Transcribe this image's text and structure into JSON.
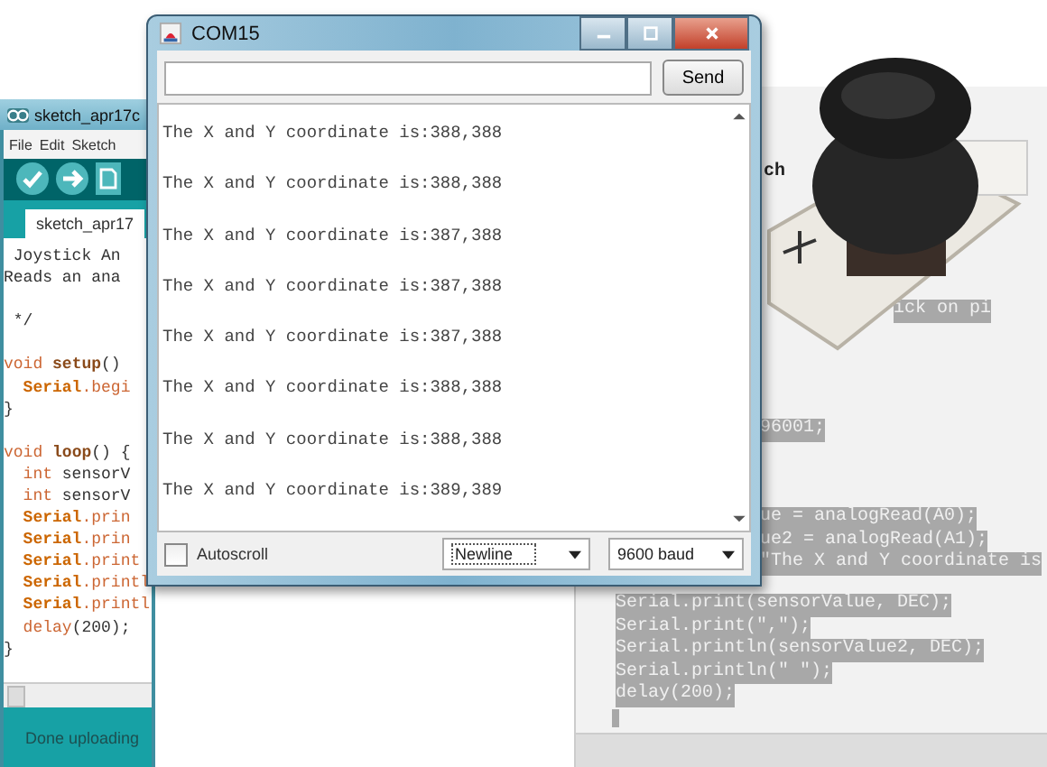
{
  "background_editor": {
    "fragments": [
      [
        "ch"
      ],
      [
        "ick on pi"
      ],
      [
        "96001;"
      ],
      [
        "ue = analogRead(A0);",
        "ue2 = analogRead(A1);",
        "\"The X and Y coordinate is"
      ],
      [
        "Serial.print(sensorValue, DEC);",
        "Serial.print(\",\");",
        "Serial.println(sensorValue2, DEC);",
        "Serial.println(\" \");",
        "delay(200);"
      ]
    ]
  },
  "ide_window": {
    "title": "sketch_apr17c",
    "menu": [
      "File",
      "Edit",
      "Sketch"
    ],
    "tab": "sketch_apr17",
    "code_blocks": [
      [
        [
          {
            "text": " Joystick An",
            "kind": "plain"
          }
        ],
        [
          {
            "text": "Reads an ana",
            "kind": "plain"
          }
        ]
      ],
      [
        [
          {
            "text": " */",
            "kind": "plain"
          }
        ]
      ],
      [
        [
          {
            "text": "void ",
            "kind": "keyword"
          },
          {
            "text": "setup",
            "kind": "function"
          },
          {
            "text": "()",
            "kind": "plain"
          }
        ],
        [
          {
            "text": "  Serial",
            "kind": "class"
          },
          {
            "text": ".begi",
            "kind": "keyword"
          }
        ],
        [
          {
            "text": "}",
            "kind": "plain"
          }
        ]
      ],
      [
        [
          {
            "text": "void ",
            "kind": "keyword"
          },
          {
            "text": "loop",
            "kind": "function"
          },
          {
            "text": "() {",
            "kind": "plain"
          }
        ],
        [
          {
            "text": "  int ",
            "kind": "keyword"
          },
          {
            "text": "sensorV",
            "kind": "plain"
          }
        ],
        [
          {
            "text": "  int ",
            "kind": "keyword"
          },
          {
            "text": "sensorV",
            "kind": "plain"
          }
        ],
        [
          {
            "text": "  Serial",
            "kind": "class"
          },
          {
            "text": ".prin",
            "kind": "keyword"
          }
        ],
        [
          {
            "text": "  Serial",
            "kind": "class"
          },
          {
            "text": ".prin",
            "kind": "keyword"
          }
        ],
        [
          {
            "text": "  Serial",
            "kind": "class"
          },
          {
            "text": ".print",
            "kind": "keyword"
          }
        ],
        [
          {
            "text": "  Serial",
            "kind": "class"
          },
          {
            "text": ".printl",
            "kind": "keyword"
          }
        ],
        [
          {
            "text": "  Serial",
            "kind": "class"
          },
          {
            "text": ".printl",
            "kind": "keyword"
          }
        ],
        [
          {
            "text": "  delay",
            "kind": "keyword"
          },
          {
            "text": "(200);",
            "kind": "plain"
          }
        ],
        [
          {
            "text": "}",
            "kind": "plain"
          }
        ]
      ]
    ],
    "status": "Done uploading"
  },
  "serial_monitor": {
    "title": "COM15",
    "send_button": "Send",
    "output": [
      "The X and Y coordinate is:388,388",
      "The X and Y coordinate is:388,388",
      "The X and Y coordinate is:387,388",
      "The X and Y coordinate is:387,388",
      "The X and Y coordinate is:387,388",
      "The X and Y coordinate is:388,388",
      "The X and Y coordinate is:388,388",
      "The X and Y coordinate is:389,389"
    ],
    "autoscroll": {
      "label": "Autoscroll",
      "checked": false
    },
    "line_ending": "Newline",
    "baud_rate": "9600 baud"
  }
}
